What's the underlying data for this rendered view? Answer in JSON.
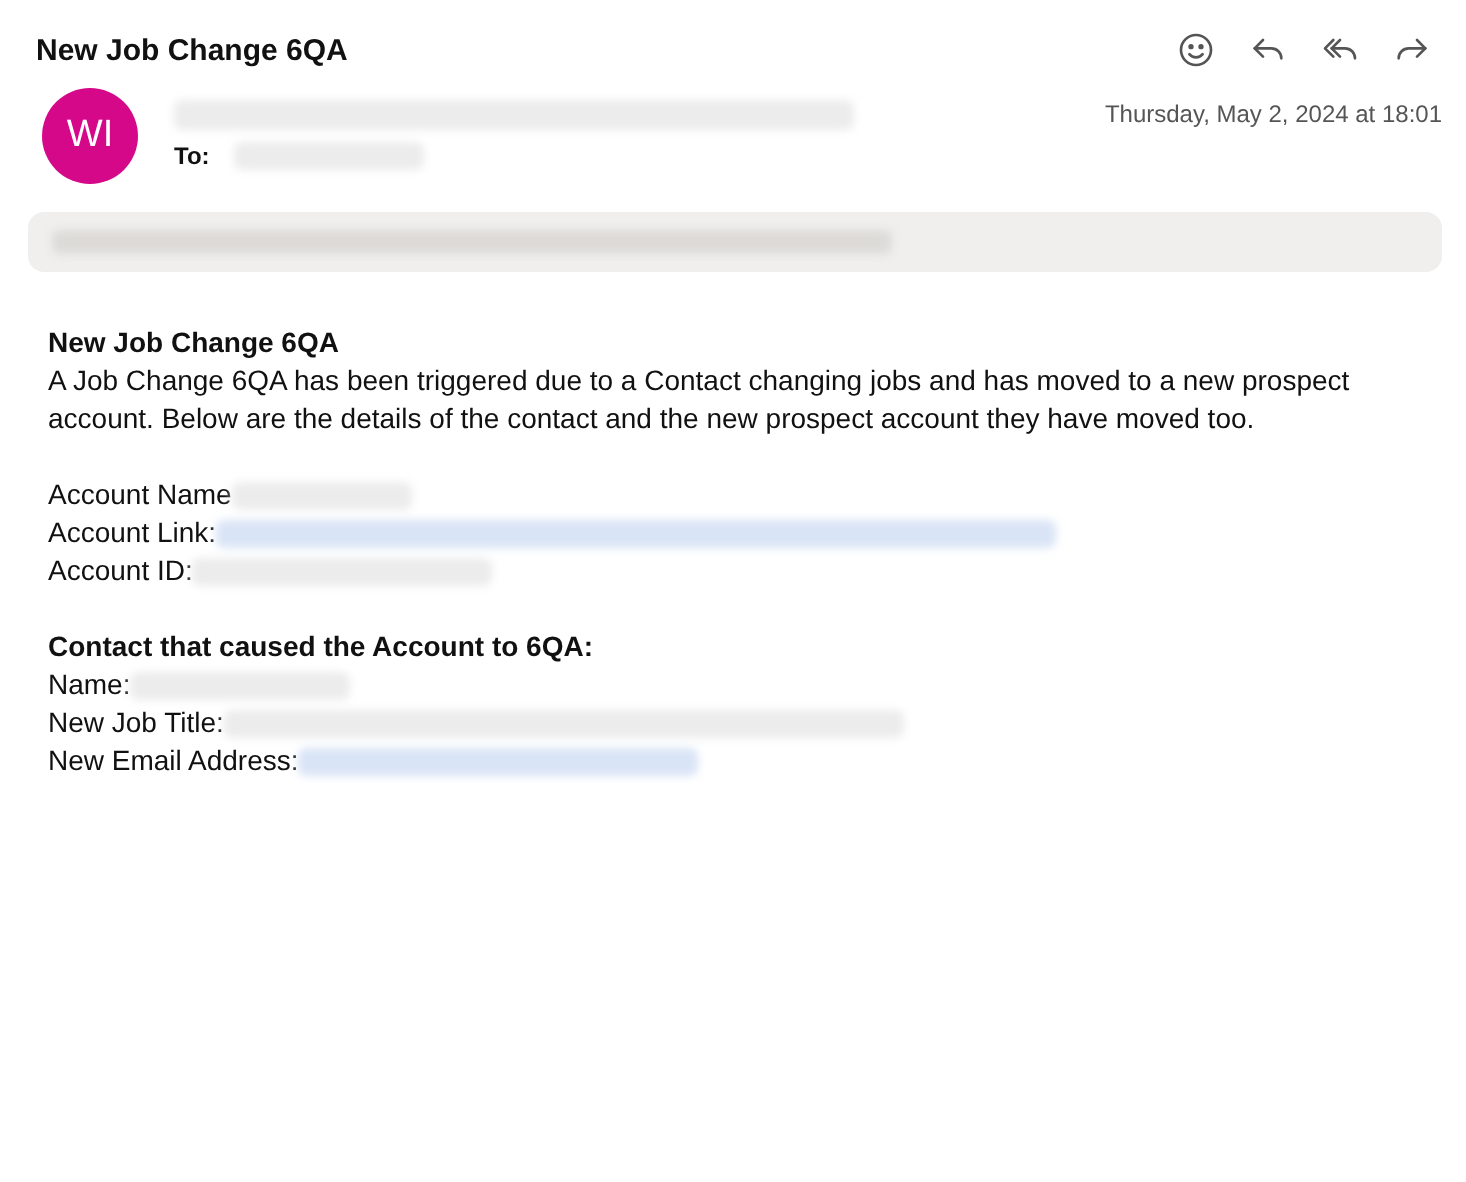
{
  "subject": "New Job Change 6QA",
  "toolbar": [
    {
      "kind": "emoji"
    },
    {
      "kind": "reply"
    },
    {
      "kind": "reply-all"
    },
    {
      "kind": "forward"
    }
  ],
  "sender": {
    "initials": "WI",
    "color": "#d6088a"
  },
  "to_label": "To:",
  "date": "Thursday, May 2, 2024 at 18:01",
  "body": {
    "heading": "New Job Change 6QA",
    "intro": "A Job Change 6QA has been triggered due to a Contact changing jobs and has moved to a new prospect account. Below are the details of the contact and the new prospect account they have moved too.",
    "account_fields": [
      {
        "label": "Account Name",
        "kind": "text"
      },
      {
        "label": "Account Link:",
        "kind": "link"
      },
      {
        "label": "Account ID:",
        "kind": "text"
      }
    ],
    "contact_heading": "Contact that caused the Account to 6QA:",
    "contact_fields": [
      {
        "label": "Name:",
        "kind": "text"
      },
      {
        "label": "New Job Title:",
        "kind": "text"
      },
      {
        "label": "New Email Address:",
        "kind": "link"
      }
    ]
  }
}
